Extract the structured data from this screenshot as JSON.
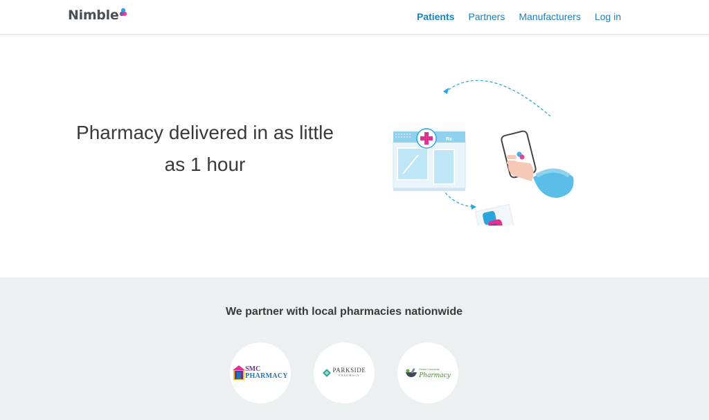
{
  "header": {
    "logo_text": "Nimble",
    "nav": [
      {
        "label": "Patients",
        "active": true
      },
      {
        "label": "Partners",
        "active": false
      },
      {
        "label": "Manufacturers",
        "active": false
      },
      {
        "label": "Log in",
        "active": false
      }
    ]
  },
  "hero": {
    "title": "Pharmacy delivered in as little as 1 hour",
    "illustration": {
      "store_sign": "Rx"
    }
  },
  "partners": {
    "title": "We partner with local pharmacies nationwide",
    "logos": [
      {
        "line1": "SMC",
        "line2": "PHARMACY"
      },
      {
        "line1": "PARKSIDE",
        "line2": "PHARMACY"
      },
      {
        "line1": "Renew Community",
        "line2": "Pharmacy"
      }
    ]
  },
  "colors": {
    "nav_link": "#1e7fb8",
    "accent_blue": "#2aa6de",
    "accent_magenta": "#e0338f",
    "partners_bg": "#ecf0f1"
  }
}
